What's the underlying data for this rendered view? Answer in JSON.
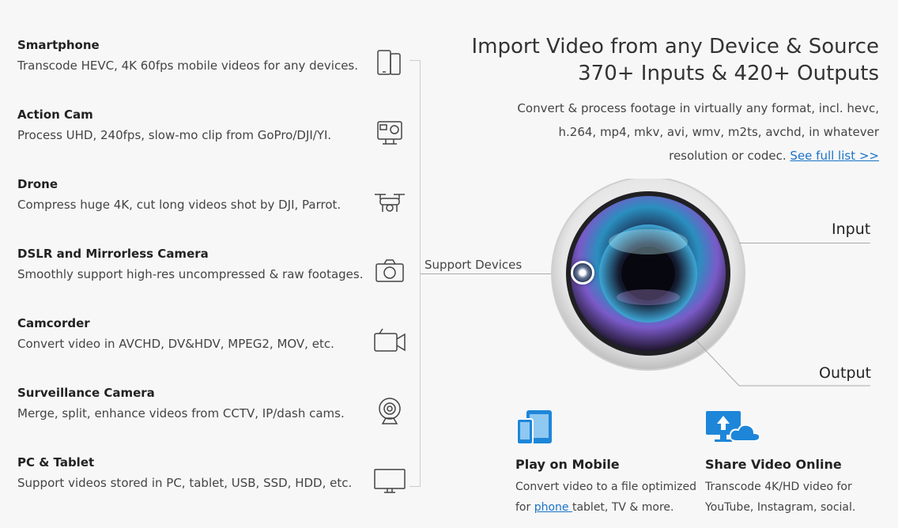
{
  "devices": [
    {
      "title": "Smartphone",
      "desc": "Transcode HEVC, 4K 60fps mobile videos for any devices.",
      "icon": "smartphone-icon"
    },
    {
      "title": "Action Cam",
      "desc": "Process UHD, 240fps, slow-mo clip from GoPro/DJI/YI.",
      "icon": "action-cam-icon"
    },
    {
      "title": "Drone",
      "desc": "Compress huge 4K, cut long videos shot by DJI, Parrot.",
      "icon": "drone-icon"
    },
    {
      "title": "DSLR and Mirrorless Camera",
      "desc": "Smoothly support high-res uncompressed & raw footages.",
      "icon": "camera-icon"
    },
    {
      "title": "Camcorder",
      "desc": "Convert video in AVCHD, DV&HDV, MPEG2, MOV, etc.",
      "icon": "camcorder-icon"
    },
    {
      "title": "Surveillance Camera",
      "desc": "Merge, split, enhance videos from CCTV, IP/dash cams.",
      "icon": "webcam-icon"
    },
    {
      "title": "PC & Tablet",
      "desc": "Support videos stored in PC, tablet, USB, SSD, HDD, etc.",
      "icon": "monitor-icon"
    }
  ],
  "support_label": "Support Devices",
  "headline": {
    "line1": "Import Video from any Device & Source",
    "line2": "370+ Inputs & 420+ Outputs"
  },
  "subtext": {
    "line1": "Convert & process footage in virtually any format, incl. hevc,",
    "line2": "h.264, mp4, mkv, avi, wmv, m2ts, avchd, in whatever",
    "line3": "resolution or codec. ",
    "link": "See full list >>"
  },
  "input_label": "Input",
  "output_label": "Output",
  "features": {
    "mobile": {
      "title": "Play on Mobile",
      "desc_pre": "Convert video to a file optimized for ",
      "link": "phone ",
      "desc_post": "tablet, TV & more.",
      "icon": "mobile-devices-icon"
    },
    "share": {
      "title": "Share Video Online",
      "desc": "Transcode 4K/HD video for YouTube, Instagram, social.",
      "icon": "cloud-upload-icon"
    }
  },
  "colors": {
    "accent": "#1a73c8",
    "text": "#333333",
    "background": "#f7f7f7"
  }
}
